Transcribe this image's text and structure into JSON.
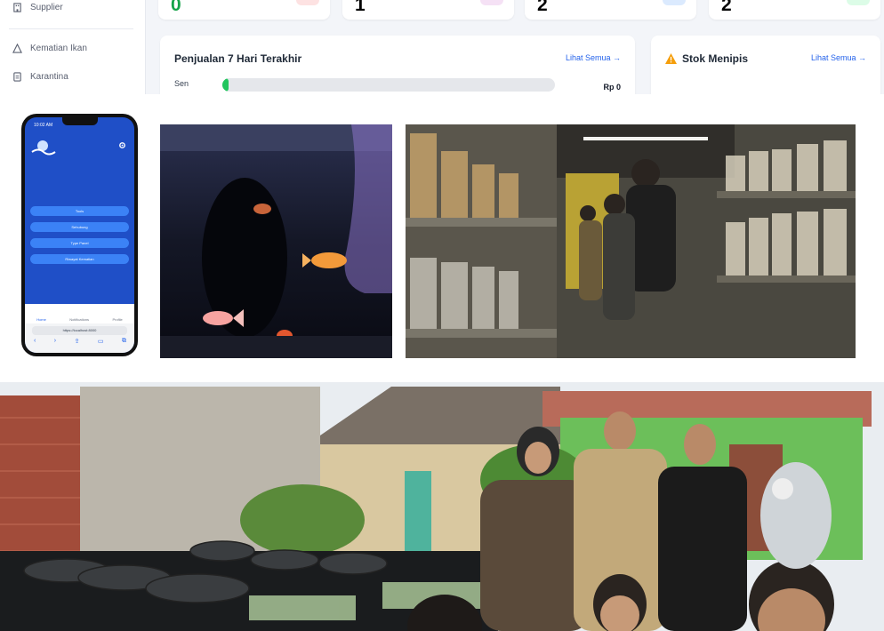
{
  "sidebar": {
    "items": [
      {
        "label": "Supplier",
        "icon": "building-icon"
      },
      {
        "label": "Kematian Ikan",
        "icon": "warning-icon"
      },
      {
        "label": "Karantina",
        "icon": "document-icon"
      }
    ]
  },
  "stats": [
    {
      "value": "0",
      "color": "#16a34a",
      "chip": "#fde2e2"
    },
    {
      "value": "1",
      "color": "#111827",
      "chip": "#f5e1f5"
    },
    {
      "value": "2",
      "color": "#111827",
      "chip": "#dbeafe"
    },
    {
      "value": "2",
      "color": "#111827",
      "chip": "#dcfce7"
    }
  ],
  "sales_panel": {
    "title": "Penjualan 7 Hari Terakhir",
    "link": "Lihat Semua →",
    "row_label": "Sen",
    "row_value": "Rp 0",
    "progress": 0.02
  },
  "stock_panel": {
    "title": "Stok Menipis",
    "link": "Lihat Semua →",
    "icon": "warning-icon"
  },
  "phone": {
    "time": "10:02 AM",
    "buttons": [
      "Tools",
      "Sehubung",
      "Type Panel",
      "Riwayat Kematian"
    ],
    "tabs": [
      "Home",
      "Notifications",
      "Profile"
    ],
    "url": "https://localhost:8000"
  },
  "colors": {
    "accent": "#2563eb",
    "success": "#22c55e",
    "app_blue": "#1f4fc7"
  }
}
